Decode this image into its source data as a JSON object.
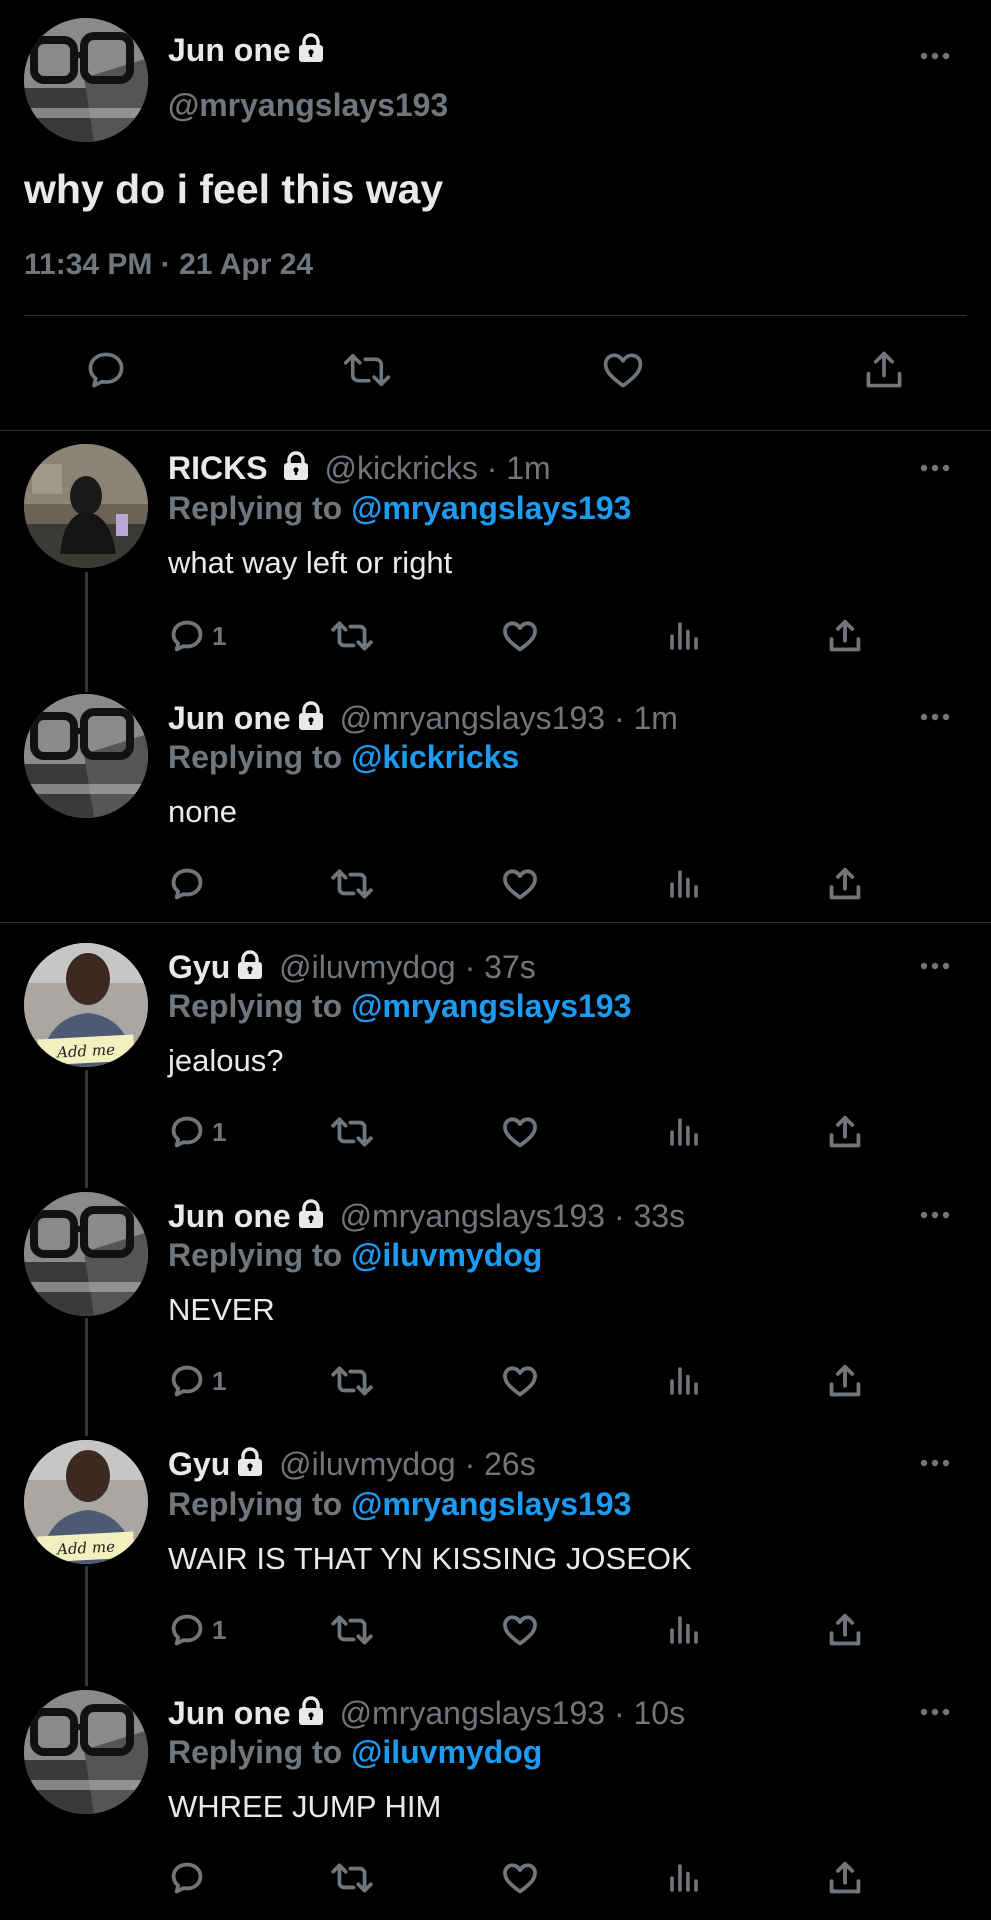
{
  "main_tweet": {
    "display_name": "Jun one",
    "handle": "@mryangslays193",
    "text": "why do i feel this way",
    "time": "11:34 PM",
    "date": "21 Apr 24",
    "time_sep": "·"
  },
  "replies": [
    {
      "display_name": "RICKS",
      "handle": "@kickricks",
      "sep": "·",
      "age": "1m",
      "replying_prefix": "Replying to",
      "replying_to": "@mryangslays193",
      "text": "what way left or right",
      "reply_count": "1"
    },
    {
      "display_name": "Jun one",
      "handle": "@mryangslays193",
      "sep": "·",
      "age": "1m",
      "replying_prefix": "Replying to",
      "replying_to": "@kickricks",
      "text": "none",
      "reply_count": ""
    },
    {
      "display_name": "Gyu",
      "handle": "@iluvmydog",
      "sep": "·",
      "age": "37s",
      "replying_prefix": "Replying to",
      "replying_to": "@mryangslays193",
      "text": "jealous?",
      "reply_count": "1",
      "avatar_sign": "Add me"
    },
    {
      "display_name": "Jun one",
      "handle": "@mryangslays193",
      "sep": "·",
      "age": "33s",
      "replying_prefix": "Replying to",
      "replying_to": "@iluvmydog",
      "text": "NEVER",
      "reply_count": "1"
    },
    {
      "display_name": "Gyu",
      "handle": "@iluvmydog",
      "sep": "·",
      "age": "26s",
      "replying_prefix": "Replying to",
      "replying_to": "@mryangslays193",
      "text": "WAIR IS THAT YN KISSING JOSEOK",
      "reply_count": "1",
      "avatar_sign": "Add me"
    },
    {
      "display_name": "Jun one",
      "handle": "@mryangslays193",
      "sep": "·",
      "age": "10s",
      "replying_prefix": "Replying to",
      "replying_to": "@iluvmydog",
      "text": "WHREE JUMP HIM",
      "reply_count": ""
    }
  ],
  "colors": {
    "background": "#000000",
    "text": "#e7e9ea",
    "muted": "#71767b",
    "link": "#1d9bf0",
    "divider": "#2f3336"
  },
  "icons": [
    "lock-icon",
    "more-icon",
    "reply-icon",
    "retweet-icon",
    "like-icon",
    "views-icon",
    "share-icon"
  ]
}
